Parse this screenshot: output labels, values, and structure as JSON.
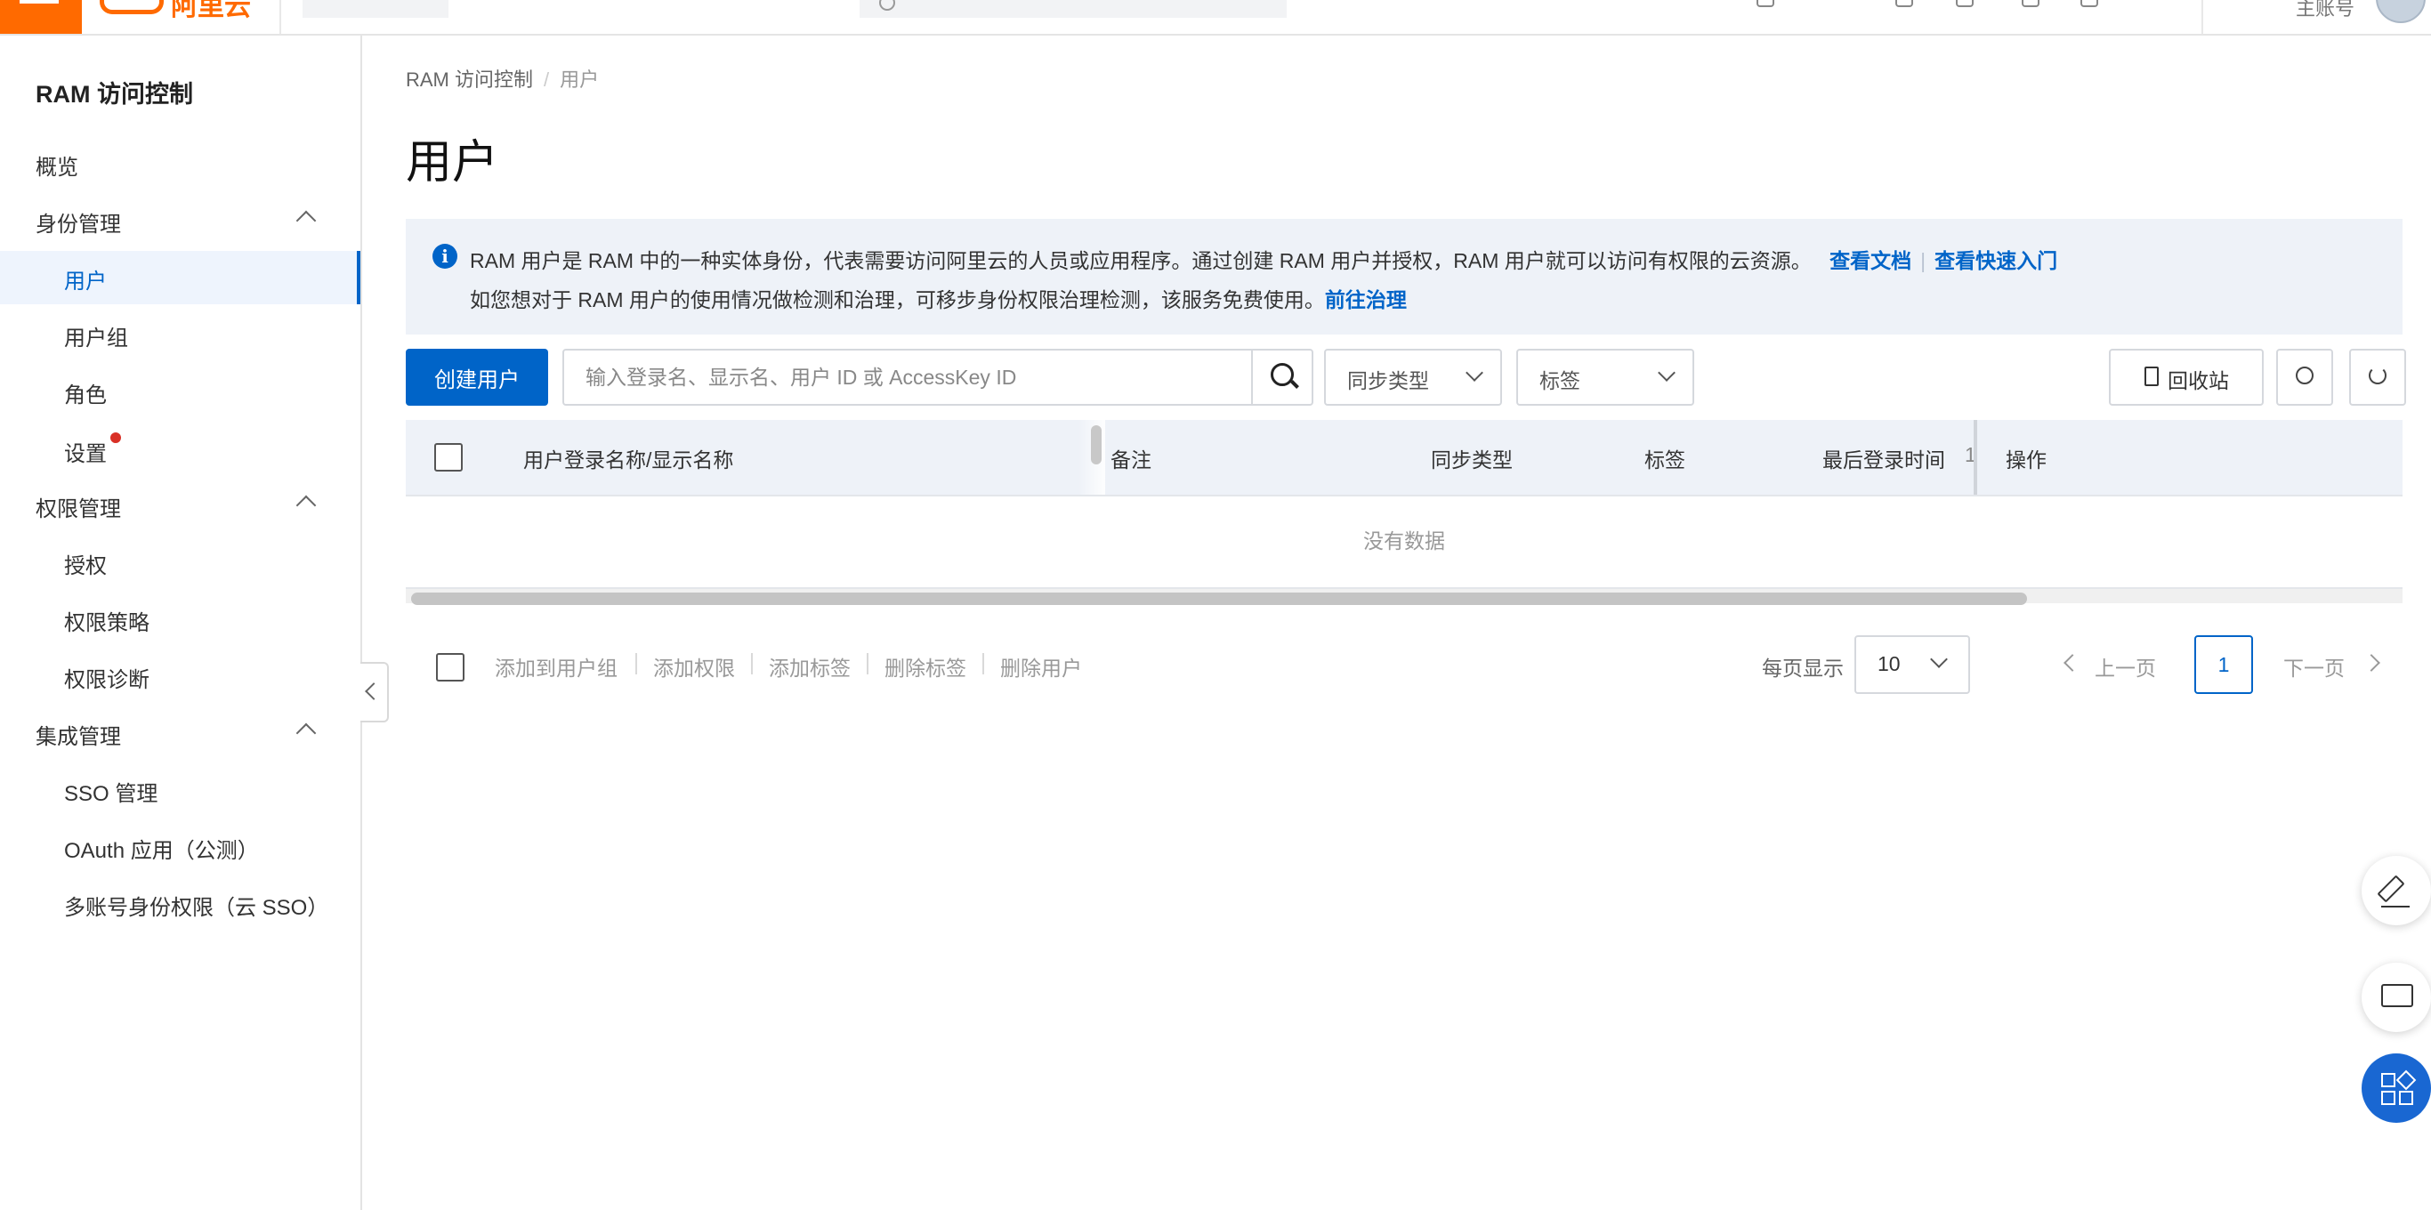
{
  "topbar": {
    "logo_text": "阿里云",
    "account_label": "主账号"
  },
  "sidebar": {
    "title": "RAM 访问控制",
    "items": [
      {
        "label": "概览"
      },
      {
        "label": "身份管理"
      },
      {
        "label": "用户",
        "active": true
      },
      {
        "label": "用户组"
      },
      {
        "label": "角色"
      },
      {
        "label": "设置"
      },
      {
        "label": "权限管理"
      },
      {
        "label": "授权"
      },
      {
        "label": "权限策略"
      },
      {
        "label": "权限诊断"
      },
      {
        "label": "集成管理"
      },
      {
        "label": "SSO 管理"
      },
      {
        "label": "OAuth 应用（公测）"
      },
      {
        "label": "多账号身份权限（云 SSO）"
      }
    ]
  },
  "breadcrumb": {
    "root": "RAM 访问控制",
    "separator": "/",
    "current": "用户"
  },
  "page_title": "用户",
  "notice": {
    "line1": "RAM 用户是 RAM 中的一种实体身份，代表需要访问阿里云的人员或应用程序。通过创建 RAM 用户并授权，RAM 用户就可以访问有权限的云资源。",
    "link_docs": "查看文档",
    "link_quickstart": "查看快速入门",
    "line2": "如您想对于 RAM 用户的使用情况做检测和治理，可移步身份权限治理检测，该服务免费使用。",
    "link_govern": "前往治理"
  },
  "toolbar": {
    "create_label": "创建用户",
    "search_placeholder": "输入登录名、显示名、用户 ID 或 AccessKey ID",
    "sync_type_label": "同步类型",
    "tag_label": "标签",
    "recycle_label": "回收站"
  },
  "table": {
    "columns": [
      "用户登录名称/显示名称",
      "备注",
      "同步类型",
      "标签",
      "最后登录时间",
      "操作"
    ],
    "sort_indicator": "1",
    "empty_text": "没有数据"
  },
  "footer": {
    "batch_actions": [
      "添加到用户组",
      "添加权限",
      "添加标签",
      "删除标签",
      "删除用户"
    ],
    "page_size_label": "每页显示",
    "page_size": "10",
    "prev_label": "上一页",
    "current_page": "1",
    "next_label": "下一页"
  },
  "colors": {
    "brand_orange": "#ff6a00",
    "primary_blue": "#0064c8",
    "notice_bg": "#eef2f8",
    "badge_red": "#d93026"
  }
}
